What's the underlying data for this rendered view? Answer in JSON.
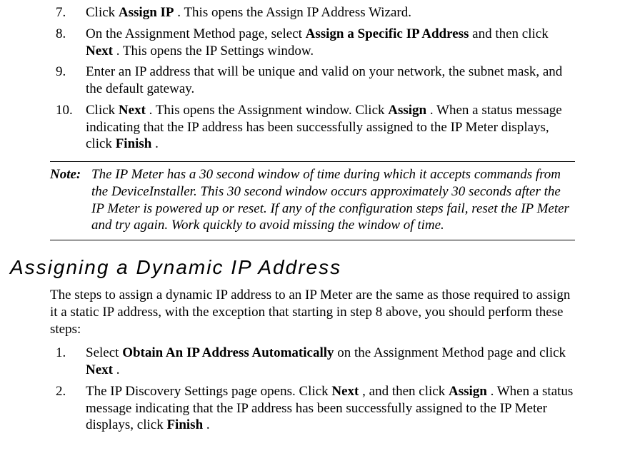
{
  "listA": [
    {
      "num": "7.",
      "segs": [
        "Click ",
        "Assign IP",
        ".  This opens the Assign IP Address Wizard."
      ]
    },
    {
      "num": "8.",
      "segs": [
        "On the Assignment Method page, select ",
        "Assign a Specific IP Address",
        " and then click ",
        "Next",
        ".  This opens the IP Settings window."
      ]
    },
    {
      "num": "9.",
      "segs": [
        "Enter an IP address that will be unique and valid on your network, the subnet mask, and the default gateway."
      ]
    },
    {
      "num": "10.",
      "segs": [
        "Click ",
        "Next",
        ".  This opens the Assignment window.  Click ",
        "Assign",
        ".  When a status message indicating that the IP address has been successfully assigned to the IP Meter displays, click ",
        "Finish",
        "."
      ]
    }
  ],
  "note": {
    "label": "Note:",
    "body": "The IP Meter has a 30 second window of time during which it accepts commands from the DeviceInstaller.  This 30 second window occurs approximately 30 seconds after the IP Meter is powered up or reset.  If any of the configuration steps fail, reset the IP Meter and try again.  Work quickly to avoid missing the window of time."
  },
  "section": {
    "title": "Assigning a Dynamic IP Address",
    "intro": "The steps to assign a dynamic IP address to an IP Meter are the same as those required to assign it a static IP address, with the exception that starting in step 8 above, you should perform these steps:"
  },
  "listB": [
    {
      "num": "1.",
      "segs": [
        "Select ",
        "Obtain An IP Address Automatically",
        " on the Assignment Method page and click ",
        "Next",
        "."
      ]
    },
    {
      "num": "2.",
      "segs": [
        "The IP Discovery Settings page opens.  Click ",
        "Next",
        ", and then click ",
        "Assign",
        ".  When a status message indicating that the IP address has been successfully assigned to the IP Meter displays, click ",
        "Finish",
        "."
      ]
    }
  ]
}
